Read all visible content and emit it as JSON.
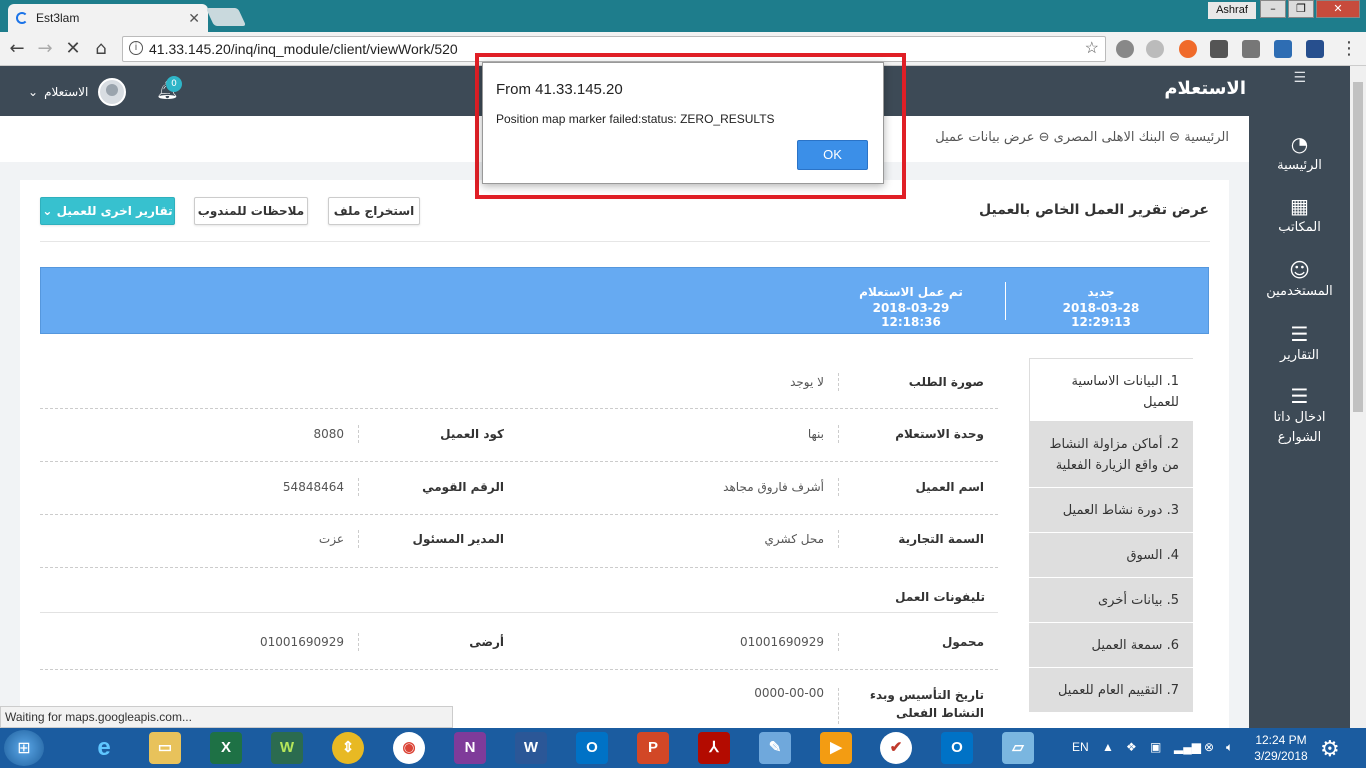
{
  "browser": {
    "tab_title": "Est3lam",
    "profile": "Ashraf",
    "url": "41.33.145.20/inq/inq_module/client/viewWork/520",
    "status_text": "Waiting for maps.googleapis.com..."
  },
  "header": {
    "app_title": "الاستعلام",
    "user_label": "الاستعلام",
    "notification_count": "0"
  },
  "sidebar": {
    "items": [
      {
        "label": "الرئيسية",
        "icon": "dashboard-icon"
      },
      {
        "label": "المكاتب",
        "icon": "building-icon"
      },
      {
        "label": "المستخدمين",
        "icon": "user-icon"
      },
      {
        "label": "التقارير",
        "icon": "list-icon"
      },
      {
        "label": "ادخال داتا الشوارع",
        "icon": "list-icon"
      }
    ]
  },
  "breadcrumb": {
    "home": "الرئيسية",
    "bank": "البنك الاهلى المصرى",
    "current": "عرض بيانات عميل"
  },
  "panel": {
    "title": "عرض تقرير العمل الخاص بالعميل",
    "export_button": "استخراج ملف",
    "notes_button": "ملاحظات للمندوب",
    "reports_button": "تقارير اخرى للعميل"
  },
  "status": {
    "new_label": "جديد",
    "new_date": "2018-03-28 12:29:13",
    "done_label": "تم عمل الاستعلام",
    "done_date": "2018-03-29 12:18:36"
  },
  "tabs": [
    "1. البيانات الاساسية للعميل",
    "2. أماكن مزاولة النشاط من واقع الزيارة الفعلية",
    "3. دورة نشاط العميل",
    "4. السوق",
    "5. بيانات أخرى",
    "6. سمعة العميل",
    "7. التقييم العام للعميل"
  ],
  "fields": {
    "request_image_label": "صورة الطلب",
    "request_image_value": "لا يوجد",
    "inquiry_unit_label": "وحدة الاستعلام",
    "inquiry_unit_value": "بنها",
    "client_code_label": "كود العميل",
    "client_code_value": "8080",
    "client_name_label": "اسم العميل",
    "client_name_value": "أشرف فاروق مجاهد",
    "national_id_label": "الرقم القومي",
    "national_id_value": "54848464",
    "trade_name_label": "السمة التجارية",
    "trade_name_value": "محل كشري",
    "manager_label": "المدير المسئول",
    "manager_value": "عزت",
    "work_phones_title": "تليفونات العمل",
    "mobile_label": "محمول",
    "mobile_value": "01001690929",
    "landline_label": "أرضى",
    "landline_value": "01001690929",
    "founding_label": "تاريخ التأسيس وبدء النشاط الفعلى",
    "founding_value": "0000-00-00"
  },
  "dialog": {
    "title": "From 41.33.145.20",
    "message": "Position map marker failed:status: ZERO_RESULTS",
    "ok": "OK"
  },
  "taskbar": {
    "language": "EN",
    "time": "12:24 PM",
    "date": "3/29/2018"
  }
}
